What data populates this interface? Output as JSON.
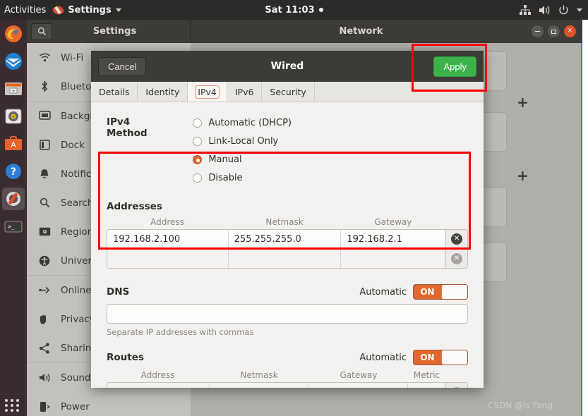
{
  "topbar": {
    "activities": "Activities",
    "app_menu": "Settings",
    "clock": "Sat 11:03",
    "icons": [
      "network-wired-icon",
      "volume-icon",
      "power-icon",
      "caret-down-icon"
    ]
  },
  "dock": {
    "items": [
      {
        "name": "firefox",
        "label": "Firefox"
      },
      {
        "name": "thunderbird",
        "label": "Thunderbird Mail"
      },
      {
        "name": "files",
        "label": "Files"
      },
      {
        "name": "rhythmbox",
        "label": "Rhythmbox"
      },
      {
        "name": "ubuntu-software",
        "label": "Ubuntu Software"
      },
      {
        "name": "help",
        "label": "Help"
      },
      {
        "name": "settings",
        "label": "Settings"
      },
      {
        "name": "terminal",
        "label": "Terminal"
      }
    ],
    "show_apps": "Show Applications"
  },
  "window": {
    "sidebar_title": "Settings",
    "panel_title": "Network",
    "search_icon": "search-icon",
    "controls": {
      "minimize": "Minimize",
      "maximize": "Maximize",
      "close": "Close"
    }
  },
  "sidebar": {
    "items": [
      {
        "label": "Wi-Fi",
        "icon": "wifi-icon"
      },
      {
        "label": "Bluetooth",
        "icon": "bluetooth-icon"
      },
      {
        "label": "Background",
        "icon": "background-icon"
      },
      {
        "label": "Dock",
        "icon": "dock-icon"
      },
      {
        "label": "Notifications",
        "icon": "bell-icon"
      },
      {
        "label": "Search",
        "icon": "search-icon"
      },
      {
        "label": "Region & Language",
        "icon": "region-icon"
      },
      {
        "label": "Universal Access",
        "icon": "accessibility-icon"
      },
      {
        "label": "Online Accounts",
        "icon": "online-accounts-icon"
      },
      {
        "label": "Privacy",
        "icon": "privacy-icon"
      },
      {
        "label": "Sharing",
        "icon": "share-icon"
      },
      {
        "label": "Sound",
        "icon": "sound-icon"
      },
      {
        "label": "Power",
        "icon": "power-icon"
      }
    ]
  },
  "dialog": {
    "title": "Wired",
    "cancel": "Cancel",
    "apply": "Apply",
    "tabs": [
      {
        "label": "Details",
        "active": false
      },
      {
        "label": "Identity",
        "active": false
      },
      {
        "label": "IPv4",
        "active": true
      },
      {
        "label": "IPv6",
        "active": false
      },
      {
        "label": "Security",
        "active": false
      }
    ],
    "ipv4_method": {
      "label": "IPv4 Method",
      "options": [
        {
          "label": "Automatic (DHCP)",
          "selected": false
        },
        {
          "label": "Link-Local Only",
          "selected": false
        },
        {
          "label": "Manual",
          "selected": true
        },
        {
          "label": "Disable",
          "selected": false
        }
      ]
    },
    "addresses": {
      "label": "Addresses",
      "columns": [
        "Address",
        "Netmask",
        "Gateway"
      ],
      "rows": [
        {
          "address": "192.168.2.100",
          "netmask": "255.255.255.0",
          "gateway": "192.168.2.1"
        },
        {
          "address": "",
          "netmask": "",
          "gateway": ""
        }
      ],
      "delete_icon": "delete-row-icon"
    },
    "dns": {
      "label": "DNS",
      "automatic_label": "Automatic",
      "automatic_state": "ON",
      "value": "",
      "hint": "Separate IP addresses with commas"
    },
    "routes": {
      "label": "Routes",
      "automatic_label": "Automatic",
      "automatic_state": "ON",
      "columns": [
        "Address",
        "Netmask",
        "Gateway",
        "Metric"
      ],
      "rows": [
        {
          "address": "",
          "netmask": "",
          "gateway": "",
          "metric": ""
        }
      ]
    }
  },
  "watermark": "CSDN @ls Fang"
}
